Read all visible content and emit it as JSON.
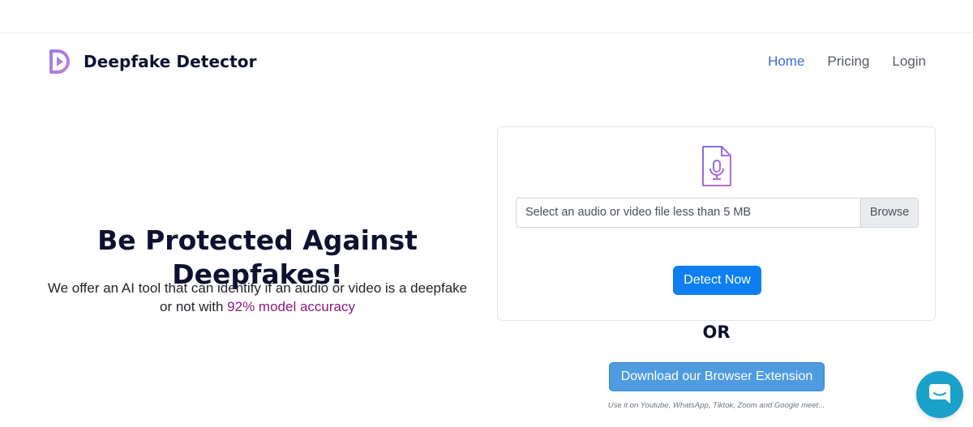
{
  "brand": {
    "name": "Deepfake Detector",
    "icon": "play-d-logo-icon"
  },
  "nav": {
    "items": [
      {
        "label": "Home",
        "active": true
      },
      {
        "label": "Pricing",
        "active": false
      },
      {
        "label": "Login",
        "active": false
      }
    ]
  },
  "hero": {
    "title": "Be Protected Against Deepfakes!",
    "subtitle_prefix": "We offer an AI tool that can identify if an audio or video is a deepfake or not with ",
    "subtitle_highlight": "92% model accuracy"
  },
  "upload": {
    "icon": "audio-file-icon",
    "placeholder": "Select an audio or video file less than 5 MB",
    "browse_label": "Browse",
    "detect_label": "Detect Now"
  },
  "alt": {
    "or_label": "OR",
    "extension_label": "Download our Browser Extension",
    "extension_note": "Use it on Youtube, WhatsApp, Tiktok, Zoom and Google meet..."
  },
  "chat": {
    "icon": "chat-bubble-icon"
  },
  "colors": {
    "accent": "#3b6bcf",
    "primary_button": "#0d7ff2",
    "highlight": "#8a1a7e",
    "chat": "#1aa1c9"
  }
}
